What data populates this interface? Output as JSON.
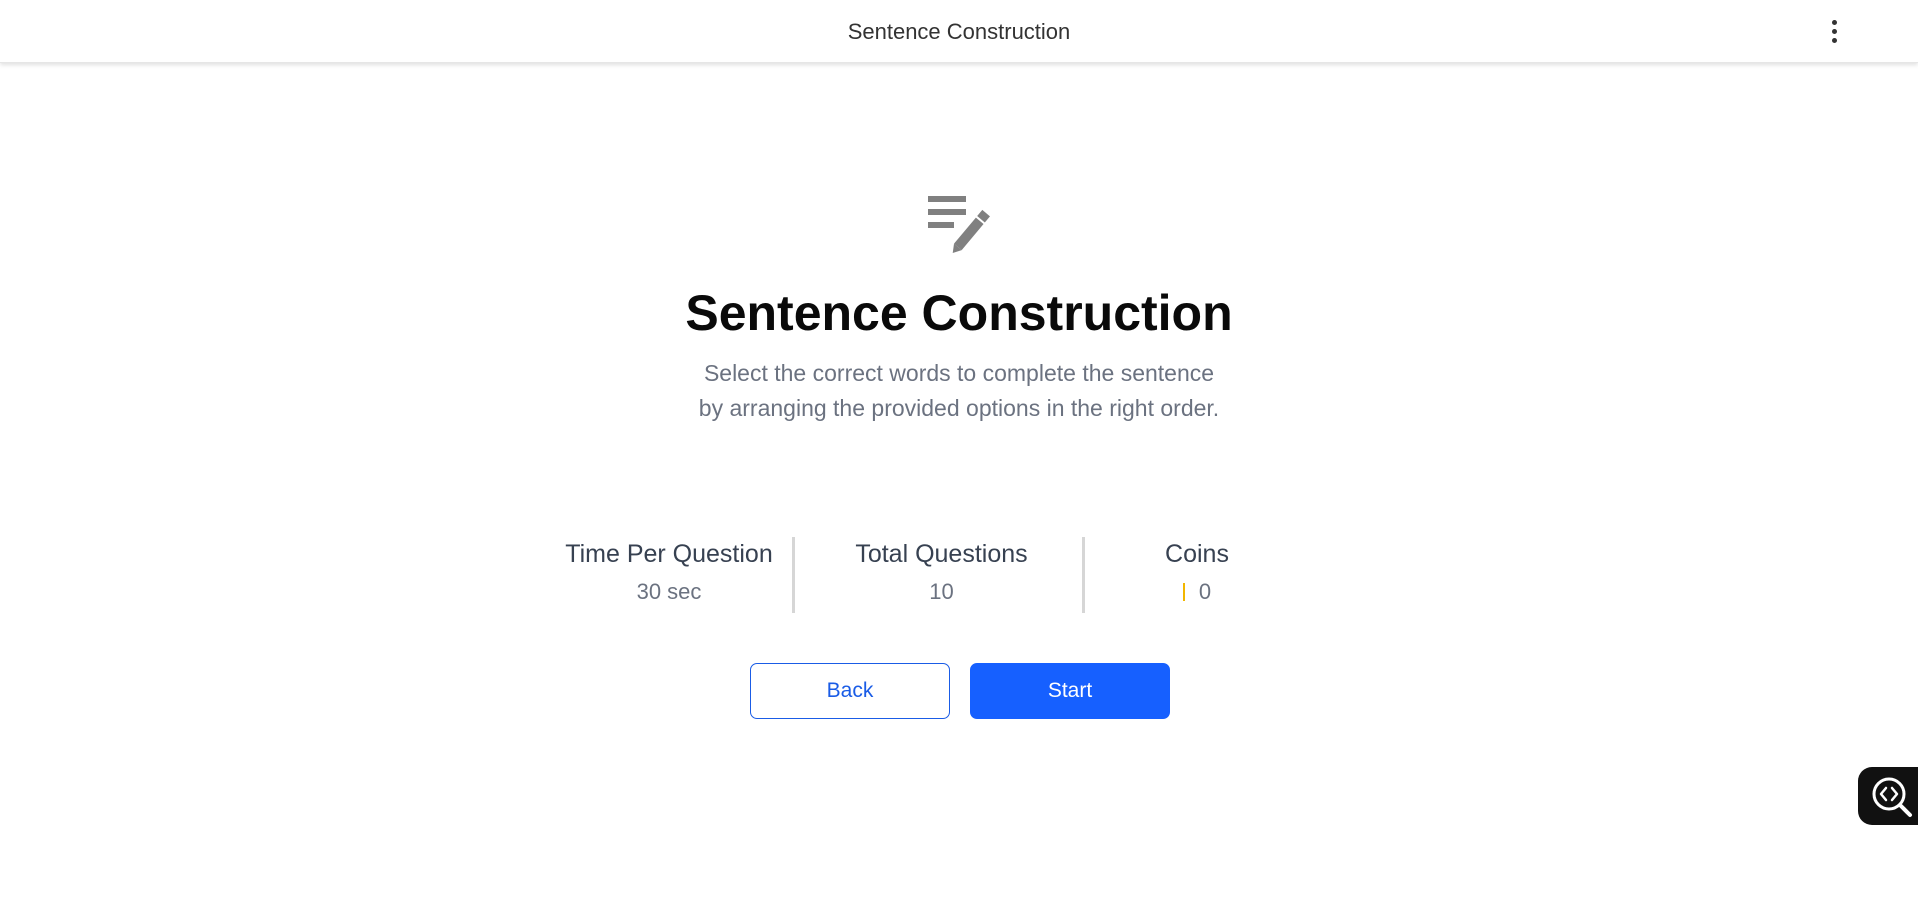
{
  "header": {
    "title": "Sentence Construction",
    "menu_icon": "more-vertical-icon"
  },
  "hero": {
    "icon": "edit-note-icon",
    "icon_color": "#808080",
    "title": "Sentence Construction",
    "subtitle_line1": "Select the correct words to complete the sentence",
    "subtitle_line2": "by arranging the provided options in the right order."
  },
  "stats": [
    {
      "label": "Time Per Question",
      "value": "30 sec"
    },
    {
      "label": "Total Questions",
      "value": "10"
    },
    {
      "label": "Coins",
      "value": "0",
      "icon": "coin-icon",
      "icon_color": "#f2b600"
    }
  ],
  "actions": {
    "back_label": "Back",
    "start_label": "Start"
  },
  "floating": {
    "icon": "code-search-icon"
  },
  "colors": {
    "accent": "#1660ff",
    "text_primary": "#0a0a0a",
    "text_muted": "#6b7280"
  }
}
